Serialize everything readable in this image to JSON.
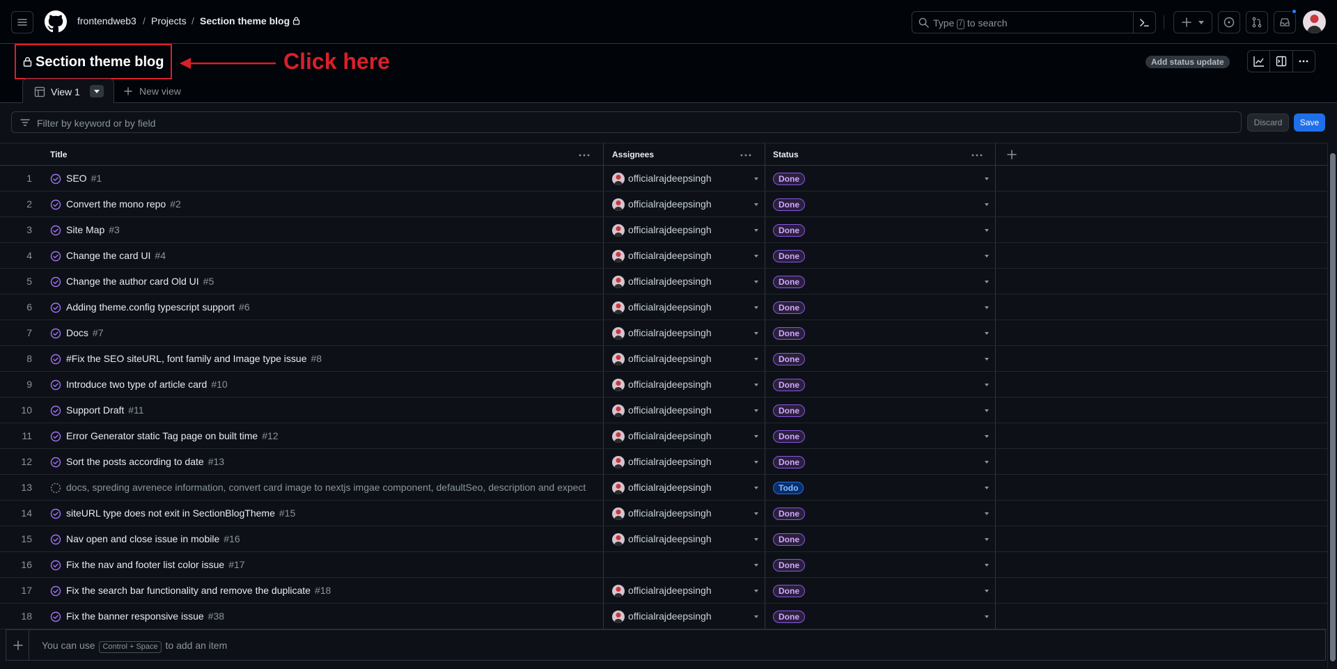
{
  "header": {
    "org": "frontendweb3",
    "projects": "Projects",
    "project": "Section theme blog",
    "search_placeholder_pre": "Type",
    "search_key": "/",
    "search_placeholder_post": "to search"
  },
  "project_header": {
    "title": "Section theme blog",
    "annotation": "Click here",
    "status_button": "Add status update"
  },
  "tabs": {
    "active": "View 1",
    "new_view": "New view"
  },
  "filter": {
    "placeholder": "Filter by keyword or by field",
    "discard": "Discard",
    "save": "Save"
  },
  "columns": {
    "title": "Title",
    "assignees": "Assignees",
    "status": "Status"
  },
  "rows": [
    {
      "num": "1",
      "title": "SEO",
      "ref": "#1",
      "assignee": "officialrajdeepsingh",
      "status": "Done"
    },
    {
      "num": "2",
      "title": "Convert the mono repo",
      "ref": "#2",
      "assignee": "officialrajdeepsingh",
      "status": "Done"
    },
    {
      "num": "3",
      "title": "Site Map",
      "ref": "#3",
      "assignee": "officialrajdeepsingh",
      "status": "Done"
    },
    {
      "num": "4",
      "title": "Change the card UI",
      "ref": "#4",
      "assignee": "officialrajdeepsingh",
      "status": "Done"
    },
    {
      "num": "5",
      "title": "Change the author card Old UI",
      "ref": "#5",
      "assignee": "officialrajdeepsingh",
      "status": "Done"
    },
    {
      "num": "6",
      "title": "Adding theme.config typescript support",
      "ref": "#6",
      "assignee": "officialrajdeepsingh",
      "status": "Done"
    },
    {
      "num": "7",
      "title": "Docs",
      "ref": "#7",
      "assignee": "officialrajdeepsingh",
      "status": "Done"
    },
    {
      "num": "8",
      "title": "#Fix the SEO siteURL, font family and Image type issue",
      "ref": "#8",
      "assignee": "officialrajdeepsingh",
      "status": "Done"
    },
    {
      "num": "9",
      "title": "Introduce two type of article card",
      "ref": "#10",
      "assignee": "officialrajdeepsingh",
      "status": "Done"
    },
    {
      "num": "10",
      "title": "Support Draft",
      "ref": "#11",
      "assignee": "officialrajdeepsingh",
      "status": "Done"
    },
    {
      "num": "11",
      "title": "Error Generator static Tag page on built time",
      "ref": "#12",
      "assignee": "officialrajdeepsingh",
      "status": "Done"
    },
    {
      "num": "12",
      "title": "Sort the posts according to date",
      "ref": "#13",
      "assignee": "officialrajdeepsingh",
      "status": "Done"
    },
    {
      "num": "13",
      "title": "docs, spreding avrenece information, convert card image to nextjs imgae component, defaultSeo, description and expect",
      "ref": "",
      "assignee": "officialrajdeepsingh",
      "status": "Todo",
      "draft": true
    },
    {
      "num": "14",
      "title": "siteURL type does not exit in SectionBlogTheme",
      "ref": "#15",
      "assignee": "officialrajdeepsingh",
      "status": "Done"
    },
    {
      "num": "15",
      "title": "Nav open and close issue in mobile",
      "ref": "#16",
      "assignee": "officialrajdeepsingh",
      "status": "Done"
    },
    {
      "num": "16",
      "title": "Fix the nav and footer list color issue",
      "ref": "#17",
      "assignee": "",
      "status": "Done"
    },
    {
      "num": "17",
      "title": "Fix the search bar functionality and remove the duplicate",
      "ref": "#18",
      "assignee": "officialrajdeepsingh",
      "status": "Done"
    },
    {
      "num": "18",
      "title": "Fix the banner responsive issue",
      "ref": "#38",
      "assignee": "officialrajdeepsingh",
      "status": "Done"
    }
  ],
  "footer": {
    "pre": "You can use",
    "shortcut": "Control + Space",
    "post": "to add an item"
  },
  "colors": {
    "background": "#010409",
    "annotation_red": "#d9202a",
    "done_purple": "#d2a8ff",
    "todo_blue": "#79c0ff",
    "save_blue": "#1f6feb"
  }
}
